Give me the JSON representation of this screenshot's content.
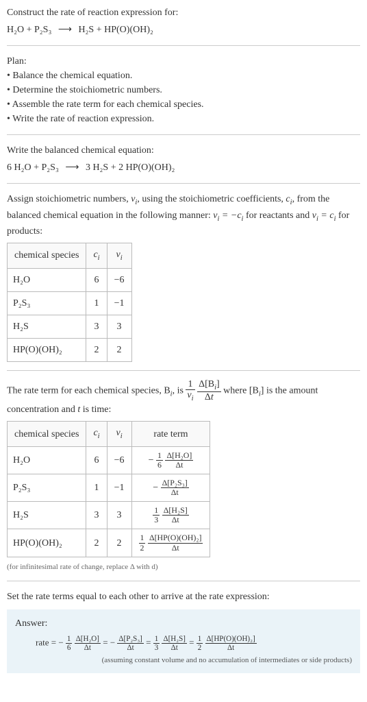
{
  "header": {
    "title": "Construct the rate of reaction expression for:",
    "unbalanced_lhs1": "H₂O",
    "unbalanced_lhs2": "P₂S₃",
    "unbalanced_rhs1": "H₂S",
    "unbalanced_rhs2": "HP(O)(OH)₂",
    "arrow": "⟶"
  },
  "plan": {
    "title": "Plan:",
    "steps": {
      "s1": "Balance the chemical equation.",
      "s2": "Determine the stoichiometric numbers.",
      "s3": "Assemble the rate term for each chemical species.",
      "s4": "Write the rate of reaction expression."
    }
  },
  "balanced": {
    "title": "Write the balanced chemical equation:",
    "c1": "6",
    "sp1": "H₂O",
    "c2": "",
    "sp2": "P₂S₃",
    "arrow": "⟶",
    "c3": "3",
    "sp3": "H₂S",
    "c4": "2",
    "sp4": "HP(O)(OH)₂"
  },
  "stoich_text": {
    "line1a": "Assign stoichiometric numbers, ",
    "line1b": ", using the stoichiometric coefficients, ",
    "line1c": ", from the balanced chemical equation in the following manner: ",
    "line1d": " for reactants and ",
    "line1e": " for products:"
  },
  "table1": {
    "h1": "chemical species",
    "h2": "cᵢ",
    "h3": "νᵢ",
    "rows": {
      "r1": {
        "sp": "H₂O",
        "c": "6",
        "v": "−6"
      },
      "r2": {
        "sp": "P₂S₃",
        "c": "1",
        "v": "−1"
      },
      "r3": {
        "sp": "H₂S",
        "c": "3",
        "v": "3"
      },
      "r4": {
        "sp": "HP(O)(OH)₂",
        "c": "2",
        "v": "2"
      }
    }
  },
  "rateterm_text": {
    "a": "The rate term for each chemical species, B",
    "b": ", is ",
    "c": " where [B",
    "d": "] is the amount concentration and ",
    "e": " is time:"
  },
  "table2": {
    "h1": "chemical species",
    "h2": "cᵢ",
    "h3": "νᵢ",
    "h4": "rate term",
    "rows": {
      "r1": {
        "sp": "H₂O",
        "c": "6",
        "v": "−6",
        "coef_num": "1",
        "coef_den": "6",
        "sign": "−",
        "d_num": "Δ[H₂O]",
        "d_den": "Δt"
      },
      "r2": {
        "sp": "P₂S₃",
        "c": "1",
        "v": "−1",
        "sign": "−",
        "d_num": "Δ[P₂S₃]",
        "d_den": "Δt"
      },
      "r3": {
        "sp": "H₂S",
        "c": "3",
        "v": "3",
        "coef_num": "1",
        "coef_den": "3",
        "sign": "",
        "d_num": "Δ[H₂S]",
        "d_den": "Δt"
      },
      "r4": {
        "sp": "HP(O)(OH)₂",
        "c": "2",
        "v": "2",
        "coef_num": "1",
        "coef_den": "2",
        "sign": "",
        "d_num": "Δ[HP(O)(OH)₂]",
        "d_den": "Δt"
      }
    }
  },
  "note_infinitesimal": "(for infinitesimal rate of change, replace Δ with d)",
  "final_text": "Set the rate terms equal to each other to arrive at the rate expression:",
  "answer": {
    "label": "Answer:",
    "lhs": "rate =",
    "assumption": "(assuming constant volume and no accumulation of intermediates or side products)"
  },
  "chart_data": {
    "type": "table",
    "title": "Stoichiometric numbers and rate terms",
    "tables": [
      {
        "columns": [
          "chemical species",
          "c_i",
          "ν_i"
        ],
        "rows": [
          [
            "H2O",
            6,
            -6
          ],
          [
            "P2S3",
            1,
            -1
          ],
          [
            "H2S",
            3,
            3
          ],
          [
            "HP(O)(OH)2",
            2,
            2
          ]
        ]
      },
      {
        "columns": [
          "chemical species",
          "c_i",
          "ν_i",
          "rate term"
        ],
        "rows": [
          [
            "H2O",
            6,
            -6,
            "-(1/6) Δ[H2O]/Δt"
          ],
          [
            "P2S3",
            1,
            -1,
            "-Δ[P2S3]/Δt"
          ],
          [
            "H2S",
            3,
            3,
            "(1/3) Δ[H2S]/Δt"
          ],
          [
            "HP(O)(OH)2",
            2,
            2,
            "(1/2) Δ[HP(O)(OH)2]/Δt"
          ]
        ]
      }
    ],
    "rate_expression": "rate = -(1/6) Δ[H2O]/Δt = -Δ[P2S3]/Δt = (1/3) Δ[H2S]/Δt = (1/2) Δ[HP(O)(OH)2]/Δt"
  }
}
